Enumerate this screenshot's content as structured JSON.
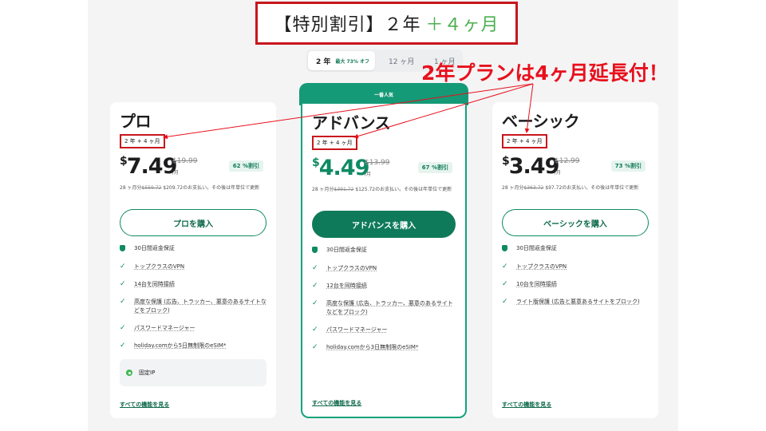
{
  "promo": {
    "main": "【特別割引】２年",
    "plus": "＋４ヶ月"
  },
  "tabs": [
    {
      "label": "2 年",
      "sub": "最大 73% オフ"
    },
    {
      "label": "12 ヶ月"
    },
    {
      "label": "1 ヶ月"
    }
  ],
  "annotation": "2年プランは4ヶ月延長付！",
  "popular_badge": "一番人気",
  "plans": [
    {
      "name": "プロ",
      "term": "2 年 + 4 ヶ月",
      "dollar": "$",
      "price": "7.49",
      "old_price": "$19.99",
      "per": "/月",
      "discount": "62 %割引",
      "billing_prefix": "28 ヶ月分",
      "billing_struck": "$559.72",
      "billing_rest": " $209.72のお支払い。その後は年単位で更新",
      "cta": "プロを購入",
      "features": [
        "30日間返金保証",
        "トップクラスのVPN",
        "14台を同時接続",
        "高度な保護 (広告、トラッカー、悪意のあるサイトなどをブロック)",
        "パスワードマネージャー",
        "holiday.comから5日無制限のeSIM*"
      ],
      "addon": "固定IP",
      "see_all": "すべての機能を見る"
    },
    {
      "name": "アドバンス",
      "term": "2 年 + 4 ヶ月",
      "dollar": "$",
      "price": "4.49",
      "old_price": "$13.99",
      "per": "/月",
      "discount": "67 %割引",
      "billing_prefix": "28 ヶ月分",
      "billing_struck": "$391.72",
      "billing_rest": " $125.72のお支払い。その後は年単位で更新",
      "cta": "アドバンスを購入",
      "features": [
        "30日間返金保証",
        "トップクラスのVPN",
        "12台を同時接続",
        "高度な保護 (広告、トラッカー、悪意のあるサイトなどをブロック)",
        "パスワードマネージャー",
        "holiday.comから3日無制限のeSIM*"
      ],
      "see_all": "すべての機能を見る"
    },
    {
      "name": "ベーシック",
      "term": "2 年 + 4 ヶ月",
      "dollar": "$",
      "price": "3.49",
      "old_price": "$12.99",
      "per": "/月",
      "discount": "73 %割引",
      "billing_prefix": "28 ヶ月分",
      "billing_struck": "$363.72",
      "billing_rest": " $97.72のお支払い。その後は年単位で更新",
      "cta": "ベーシックを購入",
      "features": [
        "30日間返金保証",
        "トップクラスのVPN",
        "10台を同時接続",
        "ライト版保護 (広告と悪意あるサイトをブロック)"
      ],
      "see_all": "すべての機能を見る"
    }
  ],
  "colors": {
    "brand_green": "#0f7a5a",
    "annotation_red": "#e8101c",
    "highlight_border": "#c8161d"
  }
}
